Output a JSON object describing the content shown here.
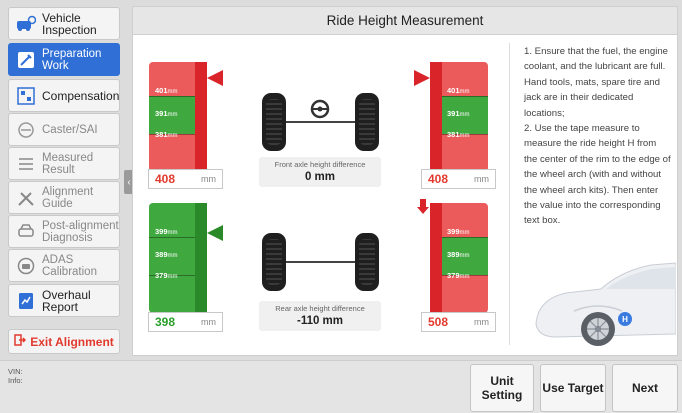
{
  "sidebar": {
    "items": [
      {
        "label": "Vehicle Inspection",
        "icon": "car-gear-icon"
      },
      {
        "label": "Preparation Work",
        "icon": "tools-icon"
      },
      {
        "label": "Compensation",
        "icon": "compensation-icon"
      },
      {
        "label": "Caster/SAI",
        "icon": "caster-icon"
      },
      {
        "label": "Measured Result",
        "icon": "list-icon"
      },
      {
        "label": "Alignment Guide",
        "icon": "wrench-screwdriver-icon"
      },
      {
        "label": "Post-alignment Diagnosis",
        "icon": "car-front-icon"
      },
      {
        "label": "ADAS Calibration",
        "icon": "adas-icon"
      },
      {
        "label": "Overhaul Report",
        "icon": "report-icon"
      }
    ],
    "exit_label": "Exit Alignment"
  },
  "header": {
    "title": "Ride Height Measurement"
  },
  "gauges": {
    "front_left": {
      "ticks": [
        "401",
        "391",
        "381"
      ],
      "value": "408",
      "unit": "mm"
    },
    "front_right": {
      "ticks": [
        "401",
        "391",
        "381"
      ],
      "value": "408",
      "unit": "mm"
    },
    "rear_left": {
      "ticks": [
        "399",
        "389",
        "379"
      ],
      "value": "398",
      "unit": "mm"
    },
    "rear_right": {
      "ticks": [
        "399",
        "389",
        "379"
      ],
      "value": "508",
      "unit": "mm"
    },
    "tick_unit": "mm"
  },
  "front_diff": {
    "label": "Front axle height difference",
    "value": "0 mm"
  },
  "rear_diff": {
    "label": "Rear axle height difference",
    "value": "-110 mm"
  },
  "instructions": "1. Ensure that the fuel, the engine coolant, and the lubricant are full. Hand tools, mats, spare tire and jack are in their dedicated locations;\n2. Use the tape measure to measure the ride height H from the center of the rim to the edge of the wheel arch (with and without the wheel arch kits). Then enter the value into the corresponding text box.",
  "car_marker": "H",
  "footer": {
    "vin_label": "VIN:",
    "info_label": "Info:",
    "unit_setting": "Unit Setting",
    "use_target": "Use Target",
    "next": "Next"
  },
  "colors": {
    "red": "#ec5b5b",
    "green": "#3fa83f",
    "accent": "#2f6fd6",
    "dark_red": "#d9252a",
    "dark_green": "#2a8a2a"
  }
}
